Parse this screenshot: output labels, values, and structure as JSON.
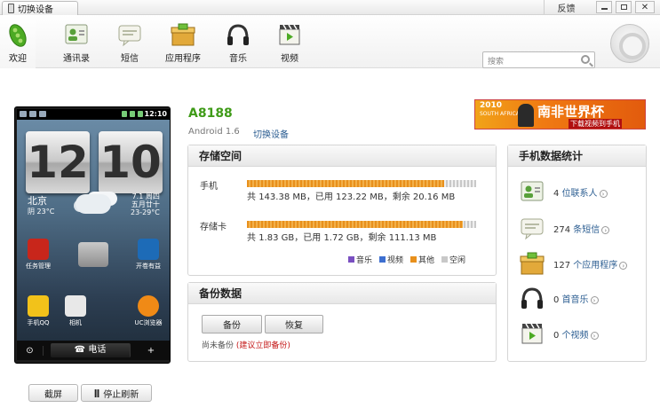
{
  "titlebar": {
    "device_tab": "切换设备",
    "feedback": "反馈"
  },
  "toolbar": {
    "items": [
      {
        "label": "欢迎",
        "icon": "peapod-icon"
      },
      {
        "label": "通讯录",
        "icon": "contacts-icon"
      },
      {
        "label": "短信",
        "icon": "sms-icon"
      },
      {
        "label": "应用程序",
        "icon": "apps-icon"
      },
      {
        "label": "音乐",
        "icon": "headphones-icon"
      },
      {
        "label": "视频",
        "icon": "video-icon"
      }
    ],
    "search_placeholder": "搜索"
  },
  "phone": {
    "clock": "12:10",
    "hour": "12",
    "minute": "10",
    "city": "北京",
    "city_temp": "阴 23°C",
    "date_line1": "7.1 周四",
    "date_line2": "五月廿十",
    "date_line3": "23-29°C",
    "apps": [
      "任务管理",
      "开卷有益",
      "手机QQ",
      "相机",
      "UC浏览器"
    ],
    "dock_call": "电话",
    "btn_screenshot": "截屏",
    "btn_stop_refresh": "停止刷新"
  },
  "device": {
    "name": "A8188",
    "os": "Android 1.6",
    "switch_label": "切换设备"
  },
  "banner": {
    "year": "2010",
    "sub": "SOUTH AFRICA",
    "title": "南非世界杯",
    "cta": "下载视频到手机"
  },
  "storage": {
    "title": "存储空间",
    "phone": {
      "label": "手机",
      "total": "143.38 MB",
      "used": "123.22 MB",
      "free": "20.16 MB",
      "used_fraction": 0.86
    },
    "sdcard": {
      "label": "存储卡",
      "total": "1.83 GB",
      "used": "1.72 GB",
      "free": "111.13 MB",
      "used_fraction": 0.94
    },
    "text_total": "共",
    "text_used": "已用",
    "text_free": "剩余",
    "legend": [
      {
        "label": "音乐",
        "color": "#7a4fc1"
      },
      {
        "label": "视频",
        "color": "#3d6fd0"
      },
      {
        "label": "其他",
        "color": "#e8901c"
      },
      {
        "label": "空闲",
        "color": "#c8c8c8"
      }
    ]
  },
  "backup": {
    "title": "备份数据",
    "backup_btn": "备份",
    "restore_btn": "恢复",
    "status": "尚未备份",
    "suggest": "(建议立即备份)"
  },
  "stats": {
    "title": "手机数据统计",
    "rows": [
      {
        "count": "4",
        "label": "位联系人",
        "icon": "contacts-icon"
      },
      {
        "count": "274",
        "label": "条短信",
        "icon": "sms-icon"
      },
      {
        "count": "127",
        "label": "个应用程序",
        "icon": "apps-icon"
      },
      {
        "count": "0",
        "label": "首音乐",
        "icon": "headphones-icon"
      },
      {
        "count": "0",
        "label": "个视频",
        "icon": "video-icon"
      }
    ]
  }
}
